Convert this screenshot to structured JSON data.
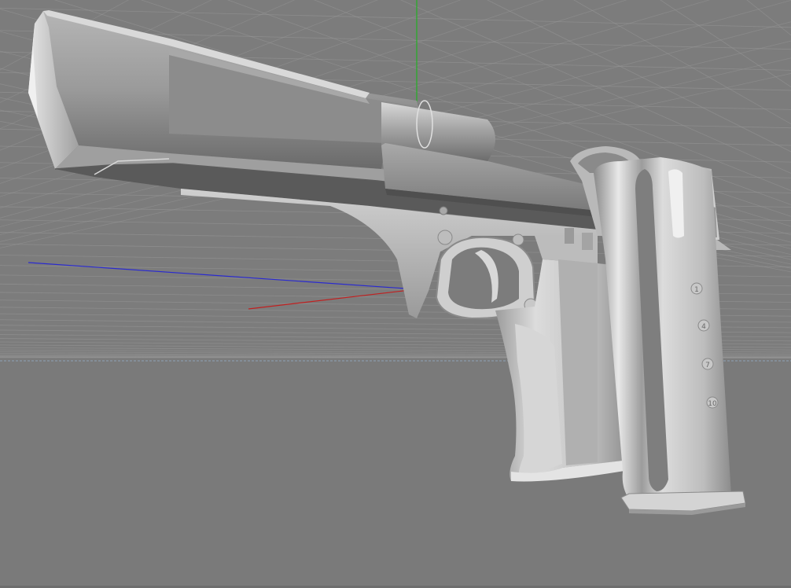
{
  "viewport": {
    "view": "perspective",
    "background_color": "#7c7c7c",
    "grid": true,
    "grid_color": "#9a9a9a",
    "horizon_line_color": "#8fa3b5",
    "axis_colors": {
      "x": "#c02020",
      "y": "#22b022",
      "z": "#2a2ad0"
    },
    "shading": "gouraud",
    "model_color": "#c4c4c4"
  },
  "model": {
    "parts": [
      "slide",
      "barrel",
      "frame",
      "trigger-guard",
      "grip",
      "magazine"
    ],
    "magazine_count_marks": [
      "1",
      "4",
      "7",
      "10"
    ]
  }
}
